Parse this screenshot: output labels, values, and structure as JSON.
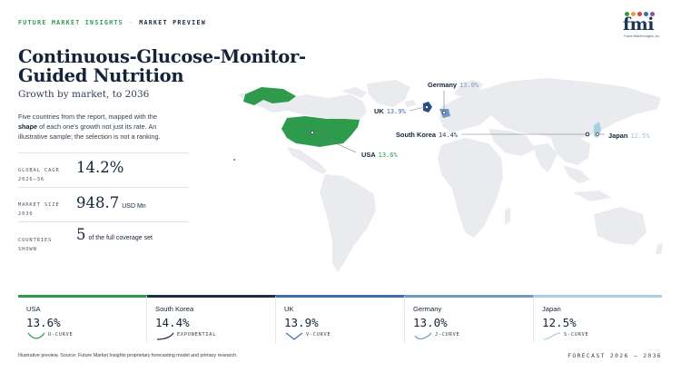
{
  "header": {
    "brand": "FUTURE MARKET INSIGHTS",
    "separator": "·",
    "section": "MARKET PREVIEW",
    "logo_text": "fmi",
    "logo_sub": "Future Market Insights, Inc."
  },
  "title": "Continuous-Glucose-Monitor-Guided Nutrition",
  "subtitle": "Growth by market, to 2036",
  "description": {
    "part1": "Five countries from the report, mapped with the ",
    "bold": "shape",
    "part2": " of each one's growth not just its rate. An illustrative sample; the selection is not a ranking."
  },
  "stats": [
    {
      "label_line1": "GLOBAL CAGR",
      "label_line2": "2026–36",
      "value": "14.2%",
      "suffix": ""
    },
    {
      "label_line1": "MARKET SIZE",
      "label_line2": "2036",
      "value": "948.7",
      "suffix": "USD Mn"
    },
    {
      "label_line1": "COUNTRIES",
      "label_line2": "SHOWN",
      "value": "5",
      "suffix": "of the full coverage set"
    }
  ],
  "map_labels": [
    {
      "name": "Germany",
      "value": "13.0%",
      "color": "#7b9fc0"
    },
    {
      "name": "UK",
      "value": "13.9%",
      "color": "#3b6fb0"
    },
    {
      "name": "South Korea",
      "value": "14.4%",
      "color": "#2a3f5c"
    },
    {
      "name": "Japan",
      "value": "12.5%",
      "color": "#9ec3d8"
    },
    {
      "name": "USA",
      "value": "13.6%",
      "color": "#2e9a4c"
    }
  ],
  "cards": [
    {
      "name": "USA",
      "value": "13.6%",
      "shape": "U-CURVE",
      "color": "#2e9a4c"
    },
    {
      "name": "South Korea",
      "value": "14.4%",
      "shape": "EXPONENTIAL",
      "color": "#1d2f48"
    },
    {
      "name": "UK",
      "value": "13.9%",
      "shape": "V-CURVE",
      "color": "#3b6fb0"
    },
    {
      "name": "Germany",
      "value": "13.0%",
      "shape": "J-CURVE",
      "color": "#6f98c4"
    },
    {
      "name": "Japan",
      "value": "12.5%",
      "shape": "S-CURVE",
      "color": "#a8cfe0"
    }
  ],
  "footer": {
    "note": "Illustrative preview. Source: Future Market Insights proprietary forecasting model and primary research.",
    "forecast": "FORECAST 2026 – 2036"
  }
}
